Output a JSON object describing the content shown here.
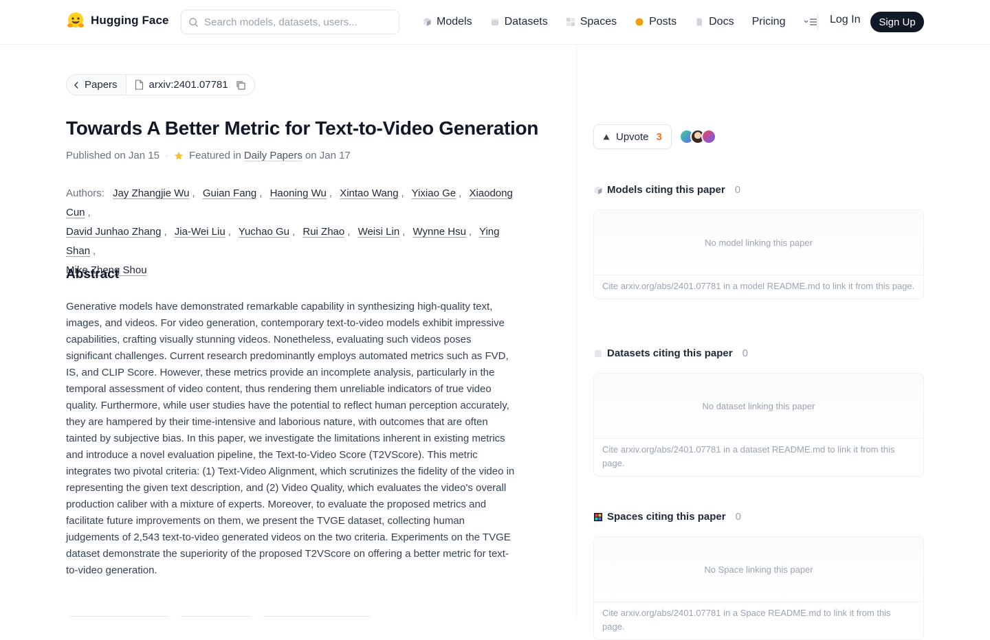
{
  "brand": {
    "name": "Hugging Face"
  },
  "search": {
    "placeholder": "Search models, datasets, users..."
  },
  "nav": {
    "items": [
      {
        "label": "Models",
        "icon": "model-cube-icon"
      },
      {
        "label": "Datasets",
        "icon": "dataset-icon"
      },
      {
        "label": "Spaces",
        "icon": "spaces-grid-icon"
      },
      {
        "label": "Posts",
        "icon": "posts-bubble-icon"
      },
      {
        "label": "Docs",
        "icon": "docs-icon"
      },
      {
        "label": "Pricing",
        "icon": ""
      }
    ],
    "login": "Log In",
    "signup": "Sign Up"
  },
  "breadcrumb": {
    "back_label": "Papers",
    "paper_id": "arxiv:2401.07781"
  },
  "paper": {
    "title": "Towards A Better Metric for Text-to-Video Generation",
    "published": "Published on Jan 15",
    "featured_prefix": "Featured in",
    "featured_link": "Daily Papers",
    "featured_suffix": "on Jan 17",
    "authors_label": "Authors:",
    "authors": [
      "Jay Zhangjie Wu",
      "Guian Fang",
      "Haoning Wu",
      "Xintao Wang",
      "Yixiao Ge",
      "Xiaodong Cun",
      "David Junhao Zhang",
      "Jia-Wei Liu",
      "Yuchao Gu",
      "Rui Zhao",
      "Weisi Lin",
      "Wynne Hsu",
      "Ying Shan",
      "Mike Zheng Shou"
    ],
    "abstract_heading": "Abstract",
    "abstract": "Generative models have demonstrated remarkable capability in synthesizing high-quality text, images, and videos. For video generation, contemporary text-to-video models exhibit impressive capabilities, crafting visually stunning videos. Nonetheless, evaluating such videos poses significant challenges. Current research predominantly employs automated metrics such as FVD, IS, and CLIP Score. However, these metrics provide an incomplete analysis, particularly in the temporal assessment of video content, thus rendering them unreliable indicators of true video quality. Furthermore, while user studies have the potential to reflect human perception accurately, they are hampered by their time-intensive and laborious nature, with outcomes that are often tainted by subjective bias. In this paper, we investigate the limitations inherent in existing metrics and introduce a novel evaluation pipeline, the Text-to-Video Score (T2VScore). This metric integrates two pivotal criteria: (1) Text-Video Alignment, which scrutinizes the fidelity of the video in representing the given text description, and (2) Video Quality, which evaluates the video's overall production caliber with a mixture of experts. Moreover, to evaluate the proposed metrics and facilitate future improvements on them, we present the TVGE dataset, collecting human judgements of 2,543 text-to-video generated videos on the two criteria. Experiments on the TVGE dataset demonstrate the superiority of the proposed T2VScore on offering a better metric for text-to-video generation."
  },
  "upvote": {
    "label": "Upvote",
    "count": "3"
  },
  "sidebar": {
    "models": {
      "heading": "Models citing this paper",
      "count": "0",
      "empty": "No model linking this paper",
      "note": "Cite arxiv.org/abs/2401.07781 in a model README.md to link it from this page."
    },
    "datasets": {
      "heading": "Datasets citing this paper",
      "count": "0",
      "empty": "No dataset linking this paper",
      "note": "Cite arxiv.org/abs/2401.07781 in a dataset README.md to link it from this page."
    },
    "spaces": {
      "heading": "Spaces citing this paper",
      "count": "0",
      "empty": "No Space linking this paper",
      "note": "Cite arxiv.org/abs/2401.07781 in a Space README.md to link it from this page."
    }
  },
  "colors": {
    "accent": "#f97316",
    "star": "#fbbf24",
    "dark": "#111827"
  }
}
